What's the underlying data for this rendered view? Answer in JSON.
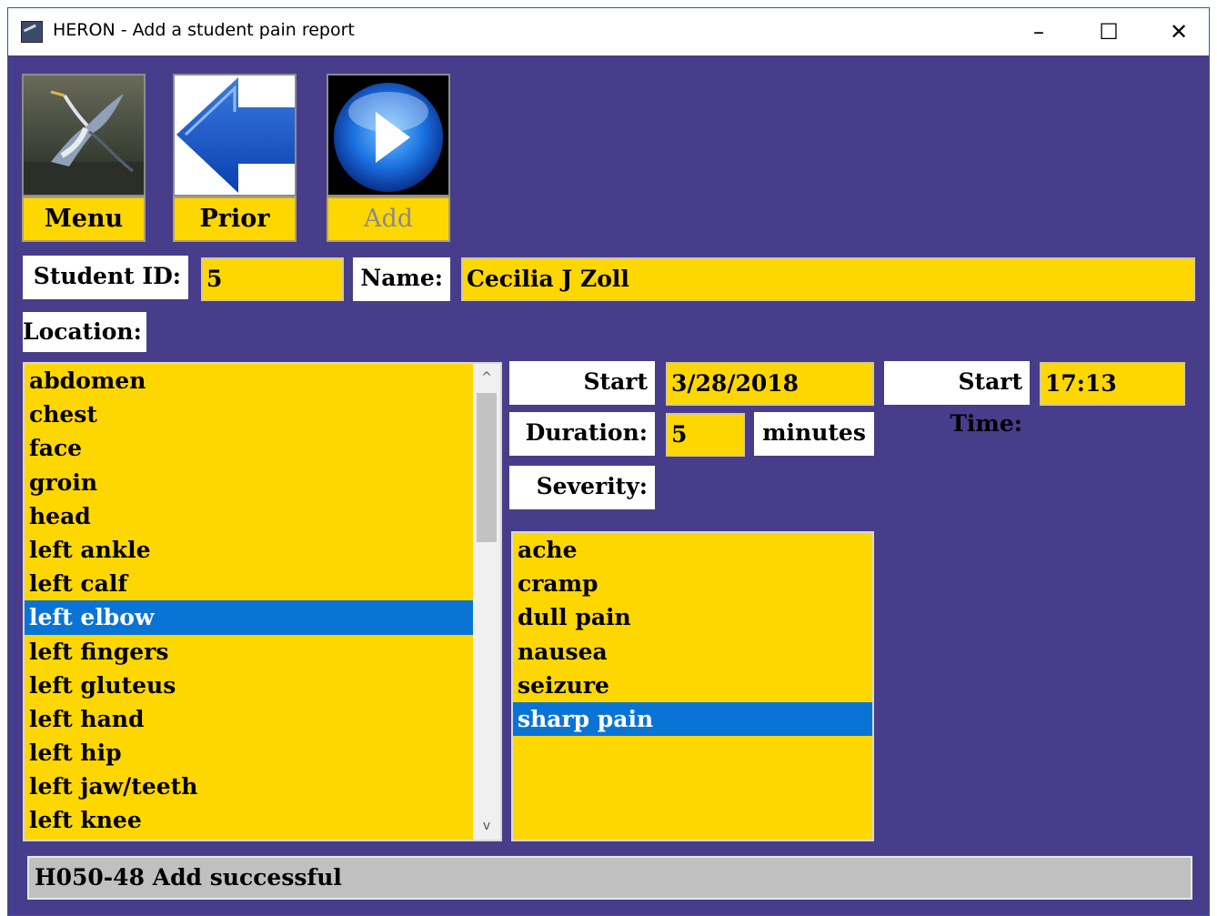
{
  "window": {
    "title": "HERON - Add a student pain report",
    "minimize": "–",
    "maximize": "☐",
    "close": "✕"
  },
  "nav": {
    "menu_label": "Menu",
    "prior_label": "Prior",
    "add_label": "Add"
  },
  "form": {
    "student_id_label": "Student ID:",
    "student_id_value": "5",
    "name_label": "Name:",
    "name_value": "Cecilia J Zoll",
    "location_label": "Location:",
    "start_date_label": "Start Date:",
    "start_date_value": "3/28/2018",
    "start_time_label": "Start Time:",
    "start_time_value": "17:13",
    "duration_label": "Duration:",
    "duration_value": "5",
    "duration_unit": "minutes",
    "severity_label": "Severity:"
  },
  "locations": {
    "items": [
      "abdomen",
      "chest",
      "face",
      "groin",
      "head",
      "left ankle",
      "left calf",
      "left elbow",
      "left fingers",
      "left gluteus",
      "left hand",
      "left hip",
      "left jaw/teeth",
      "left knee"
    ],
    "selected": "left elbow",
    "scroll_up": "^",
    "scroll_down": "v"
  },
  "severity": {
    "items": [
      "ache",
      "cramp",
      "dull pain",
      "nausea",
      "seizure",
      "sharp pain"
    ],
    "selected": "sharp pain"
  },
  "status": {
    "message": "H050-48 Add successful"
  },
  "colors": {
    "background": "#483d8b",
    "field": "#ffd700",
    "selection": "#0a74d6"
  }
}
